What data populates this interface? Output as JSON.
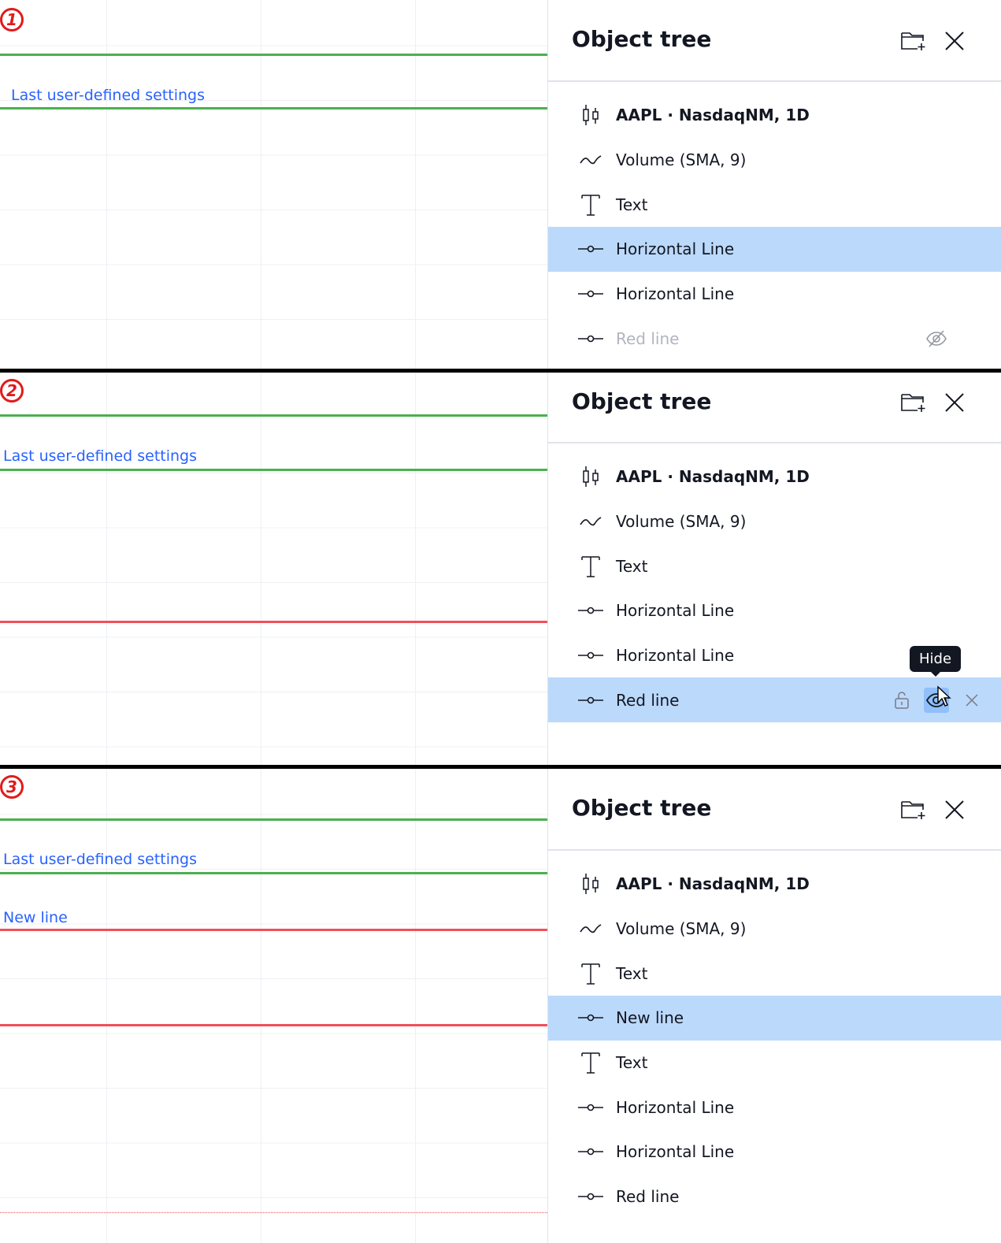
{
  "steps": [
    {
      "badge": "1",
      "chart": {
        "label": "Last user-defined settings"
      },
      "panel": {
        "title": "Object tree",
        "rows": [
          {
            "label": "AAPL · NasdaqNM, 1D",
            "icon": "candles-icon"
          },
          {
            "label": "Volume (SMA, 9)",
            "icon": "wave-icon"
          },
          {
            "label": "Text",
            "icon": "text-icon"
          },
          {
            "label": "Horizontal Line",
            "icon": "horizontal-line-icon",
            "selected": true
          },
          {
            "label": "Horizontal Line",
            "icon": "horizontal-line-icon"
          },
          {
            "label": "Red line",
            "icon": "horizontal-line-icon",
            "hidden": true
          }
        ]
      }
    },
    {
      "badge": "2",
      "chart": {
        "label": "Last user-defined settings"
      },
      "panel": {
        "title": "Object tree",
        "rows": [
          {
            "label": "AAPL · NasdaqNM, 1D",
            "icon": "candles-icon"
          },
          {
            "label": "Volume (SMA, 9)",
            "icon": "wave-icon"
          },
          {
            "label": "Text",
            "icon": "text-icon"
          },
          {
            "label": "Horizontal Line",
            "icon": "horizontal-line-icon"
          },
          {
            "label": "Horizontal Line",
            "icon": "horizontal-line-icon"
          },
          {
            "label": "Red line",
            "icon": "horizontal-line-icon",
            "selected": true,
            "hovered": true
          }
        ],
        "tooltip": "Hide"
      }
    },
    {
      "badge": "3",
      "chart": {
        "label": "Last user-defined settings",
        "label2": "New line"
      },
      "panel": {
        "title": "Object tree",
        "rows": [
          {
            "label": "AAPL · NasdaqNM, 1D",
            "icon": "candles-icon"
          },
          {
            "label": "Volume (SMA, 9)",
            "icon": "wave-icon"
          },
          {
            "label": "Text",
            "icon": "text-icon"
          },
          {
            "label": "New line",
            "icon": "horizontal-line-icon",
            "selected": true
          },
          {
            "label": "Text",
            "icon": "text-icon"
          },
          {
            "label": "Horizontal Line",
            "icon": "horizontal-line-icon"
          },
          {
            "label": "Horizontal Line",
            "icon": "horizontal-line-icon"
          },
          {
            "label": "Red line",
            "icon": "horizontal-line-icon"
          }
        ]
      }
    }
  ],
  "colors": {
    "green_line": "#4caf50",
    "red_line": "#f0505a",
    "label_blue": "#2962ff",
    "selected_row": "#bbd9fb",
    "badge_red": "#e01b1b"
  }
}
